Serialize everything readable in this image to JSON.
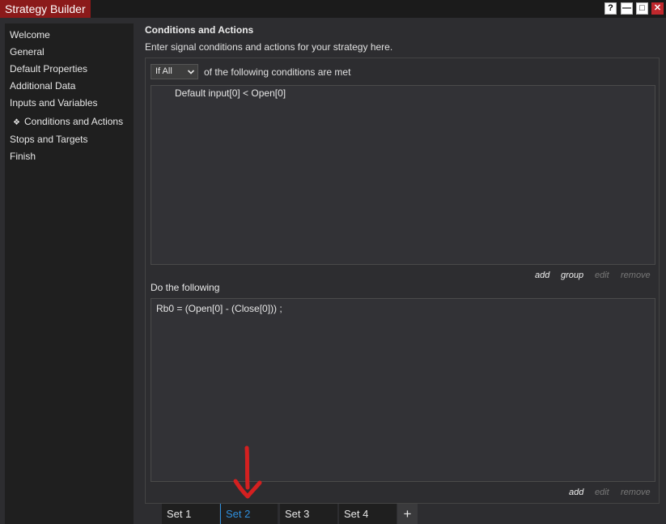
{
  "window": {
    "title": "Strategy Builder",
    "buttons": {
      "help": "?",
      "minimize": "—",
      "maximize": "□",
      "close": "✕"
    }
  },
  "sidebar": {
    "items": [
      {
        "label": "Welcome"
      },
      {
        "label": "General"
      },
      {
        "label": "Default Properties"
      },
      {
        "label": "Additional Data"
      },
      {
        "label": "Inputs and Variables"
      },
      {
        "label": "Conditions and Actions",
        "bullet": "❖",
        "selected": true
      },
      {
        "label": "Stops and Targets"
      },
      {
        "label": "Finish"
      }
    ]
  },
  "main": {
    "title": "Conditions and Actions",
    "description": "Enter signal conditions and actions for your strategy here.",
    "conditions": {
      "mode_value": "If All",
      "mode_suffix": "of the following conditions are met",
      "items": [
        "Default input[0] < Open[0]"
      ],
      "actions": {
        "add": "add",
        "group": "group",
        "edit": "edit",
        "remove": "remove"
      }
    },
    "do_following": {
      "label": "Do the following",
      "items": [
        "Rb0 = (Open[0] - (Close[0])) ;"
      ],
      "actions": {
        "add": "add",
        "edit": "edit",
        "remove": "remove"
      }
    }
  },
  "tabs": {
    "items": [
      {
        "label": "Set 1"
      },
      {
        "label": "Set 2",
        "active": true
      },
      {
        "label": "Set 3"
      },
      {
        "label": "Set 4"
      }
    ],
    "add_label": "+"
  },
  "colors": {
    "accent": "#2f8fdd",
    "title_bar": "#8b1a1a",
    "annotation_arrow": "#d42020"
  },
  "icons": {
    "select_chevron": "chevron-down-icon",
    "annotation": "red-arrow-annotation"
  }
}
